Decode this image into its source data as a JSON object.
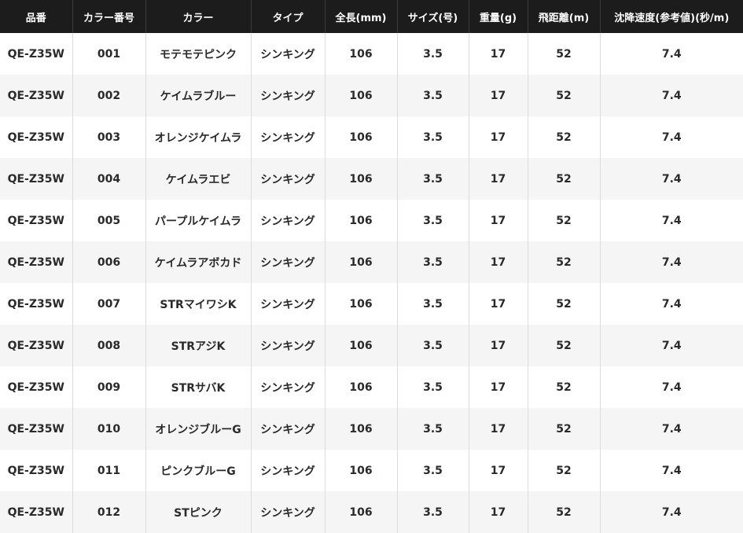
{
  "table": {
    "headers": [
      "品番",
      "カラー番号",
      "カラー",
      "タイプ",
      "全長(mm)",
      "サイズ(号)",
      "重量(g)",
      "飛距離(m)",
      "沈降速度(参考値)(秒/m)"
    ],
    "rows": [
      [
        "QE-Z35W",
        "001",
        "モテモテピンク",
        "シンキング",
        "106",
        "3.5",
        "17",
        "52",
        "7.4"
      ],
      [
        "QE-Z35W",
        "002",
        "ケイムラブルー",
        "シンキング",
        "106",
        "3.5",
        "17",
        "52",
        "7.4"
      ],
      [
        "QE-Z35W",
        "003",
        "オレンジケイムラ",
        "シンキング",
        "106",
        "3.5",
        "17",
        "52",
        "7.4"
      ],
      [
        "QE-Z35W",
        "004",
        "ケイムラエビ",
        "シンキング",
        "106",
        "3.5",
        "17",
        "52",
        "7.4"
      ],
      [
        "QE-Z35W",
        "005",
        "パープルケイムラ",
        "シンキング",
        "106",
        "3.5",
        "17",
        "52",
        "7.4"
      ],
      [
        "QE-Z35W",
        "006",
        "ケイムラアボカド",
        "シンキング",
        "106",
        "3.5",
        "17",
        "52",
        "7.4"
      ],
      [
        "QE-Z35W",
        "007",
        "STRマイワシK",
        "シンキング",
        "106",
        "3.5",
        "17",
        "52",
        "7.4"
      ],
      [
        "QE-Z35W",
        "008",
        "STRアジK",
        "シンキング",
        "106",
        "3.5",
        "17",
        "52",
        "7.4"
      ],
      [
        "QE-Z35W",
        "009",
        "STRサバK",
        "シンキング",
        "106",
        "3.5",
        "17",
        "52",
        "7.4"
      ],
      [
        "QE-Z35W",
        "010",
        "オレンジブルーG",
        "シンキング",
        "106",
        "3.5",
        "17",
        "52",
        "7.4"
      ],
      [
        "QE-Z35W",
        "011",
        "ピンクブルーG",
        "シンキング",
        "106",
        "3.5",
        "17",
        "52",
        "7.4"
      ],
      [
        "QE-Z35W",
        "012",
        "STピンク",
        "シンキング",
        "106",
        "3.5",
        "17",
        "52",
        "7.4"
      ]
    ]
  }
}
